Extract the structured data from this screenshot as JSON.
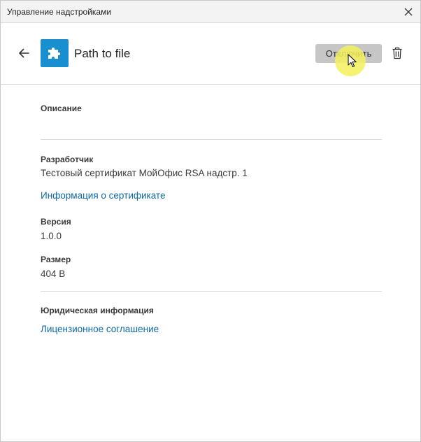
{
  "window": {
    "title": "Управление надстройками"
  },
  "header": {
    "addin_name": "Path to file",
    "disable_label": "Отключить"
  },
  "details": {
    "description_label": "Описание",
    "developer_label": "Разработчик",
    "developer_value": "Тестовый сертификат МойОфис RSA надстр. 1",
    "certificate_link": "Информация о сертификате",
    "version_label": "Версия",
    "version_value": "1.0.0",
    "size_label": "Размер",
    "size_value": "404 B",
    "legal_label": "Юридическая информация",
    "license_link": "Лицензионное соглашение"
  },
  "colors": {
    "accent": "#1a8fd0",
    "link": "#0f6aa6",
    "button_bg": "#c6c6c6"
  },
  "icons": {
    "close": "close-icon",
    "back": "arrow-left-icon",
    "addin": "puzzle-icon",
    "delete": "trash-icon",
    "pointer": "mouse-pointer-icon"
  }
}
